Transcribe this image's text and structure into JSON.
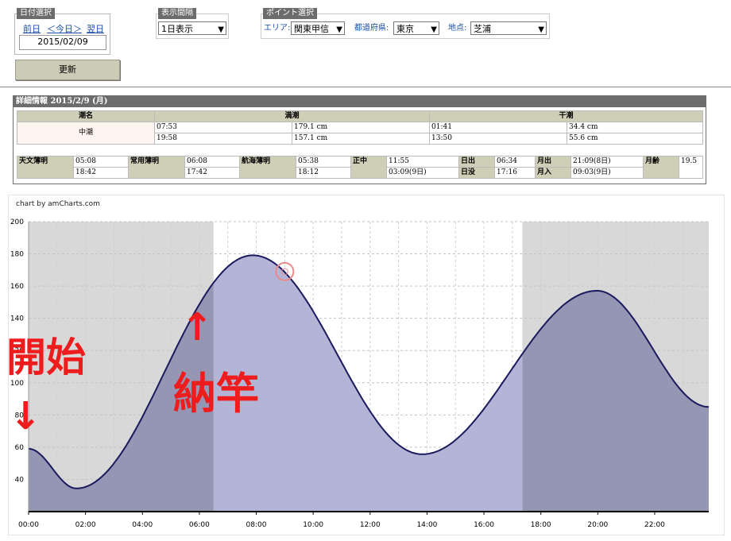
{
  "date_select": {
    "legend": "日付選択",
    "prev": "前日",
    "today": "＜今日＞",
    "next": "翌日",
    "date": "2015/02/09"
  },
  "interval": {
    "legend": "表示間隔",
    "value": "1日表示"
  },
  "point": {
    "legend": "ポイント選択",
    "area_label": "エリア:",
    "area_value": "関東甲信",
    "pref_label": "都道府県:",
    "pref_value": "東京",
    "spot_label": "地点:",
    "spot_value": "芝浦"
  },
  "update_button": "更新",
  "detail": {
    "title": "詳細情報  2015/2/9 (月)",
    "headers": [
      "潮名",
      "満潮",
      "干潮"
    ],
    "tide_name": "中潮",
    "high": [
      {
        "time": "07:53",
        "height": "179.1 cm"
      },
      {
        "time": "19:58",
        "height": "157.1 cm"
      }
    ],
    "low": [
      {
        "time": "01:41",
        "height": "34.4 cm"
      },
      {
        "time": "13:50",
        "height": "55.6 cm"
      }
    ],
    "astro_label": "天文薄明",
    "astro": [
      "05:08",
      "18:42"
    ],
    "civil_label": "常用薄明",
    "civil": [
      "06:08",
      "17:42"
    ],
    "nautical_label": "航海薄明",
    "nautical": [
      "05:38",
      "18:12"
    ],
    "noon_label": "正中",
    "noon": [
      "11:55",
      "03:09(9日)"
    ],
    "sunrise_label": "日出",
    "sunrise": "06:34",
    "sunset_label": "日没",
    "sunset": "17:16",
    "moonrise_label": "月出",
    "moonrise": "21:09(8日)",
    "moonset_label": "月入",
    "moonset": "09:03(9日)",
    "moonage_label": "月齢",
    "moonage": "19.5"
  },
  "chart_credit": "chart by amCharts.com",
  "annotations": {
    "start": "開始",
    "nosao": "納竿",
    "up_arrow": "↑",
    "down_arrow": "↓"
  },
  "colors": {
    "night_band": "#d8d8d8",
    "fill_night": "#9595b4",
    "fill_day": "#b4b4d6",
    "line": "#1a1a5e",
    "annotation": "#ee1c1c",
    "cursor": "#e88a8a"
  },
  "chart_data": {
    "type": "area",
    "title": "",
    "xlabel": "",
    "ylabel": "",
    "xlim_hours": [
      0,
      23.9
    ],
    "ylim": [
      20,
      200
    ],
    "y_ticks": [
      40,
      60,
      80,
      100,
      120,
      140,
      160,
      180,
      200
    ],
    "x_ticks": [
      "00:00",
      "02:00",
      "04:00",
      "06:00",
      "08:00",
      "10:00",
      "12:00",
      "14:00",
      "16:00",
      "18:00",
      "20:00",
      "22:00"
    ],
    "x_tick_hours": [
      0,
      2,
      4,
      6,
      8,
      10,
      12,
      14,
      16,
      18,
      20,
      22
    ],
    "night_periods_hours": [
      [
        0,
        6.5
      ],
      [
        17.35,
        23.9
      ]
    ],
    "cursor_hour": 9.0,
    "cursor_value": 169,
    "tide_extremes": [
      {
        "hour": 0,
        "value": 59
      },
      {
        "hour": 1.68,
        "value": 34.4
      },
      {
        "hour": 7.88,
        "value": 179.1
      },
      {
        "hour": 13.83,
        "value": 55.6
      },
      {
        "hour": 19.97,
        "value": 157.1
      },
      {
        "hour": 23.9,
        "value": 85
      }
    ]
  }
}
